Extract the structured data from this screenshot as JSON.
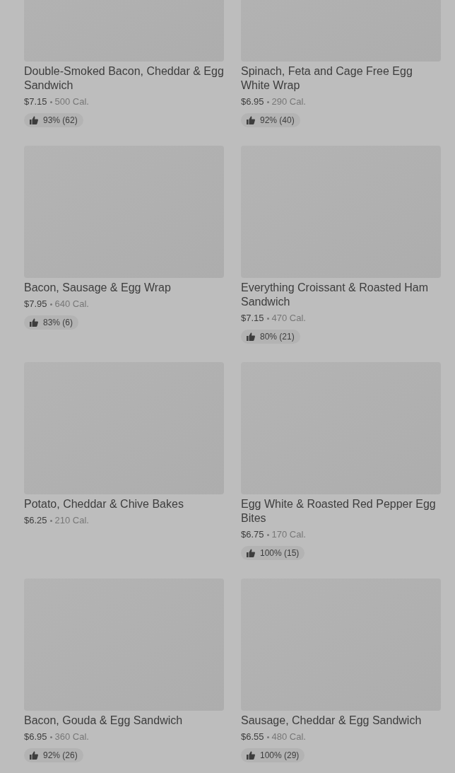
{
  "items": [
    {
      "name": "Double-Smoked Bacon, Cheddar & Egg Sandwich",
      "price": "$7.15",
      "calories": "500 Cal.",
      "rating": "93% (62)"
    },
    {
      "name": "Spinach, Feta and Cage Free Egg White Wrap",
      "price": "$6.95",
      "calories": "290 Cal.",
      "rating": "92% (40)"
    },
    {
      "name": "Bacon, Sausage & Egg Wrap",
      "price": "$7.95",
      "calories": "640 Cal.",
      "rating": "83% (6)"
    },
    {
      "name": "Everything Croissant & Roasted Ham Sandwich",
      "price": "$7.15",
      "calories": "470 Cal.",
      "rating": "80% (21)"
    },
    {
      "name": "Potato, Cheddar & Chive Bakes",
      "price": "$6.25",
      "calories": "210 Cal."
    },
    {
      "name": "Egg White & Roasted Red Pepper Egg Bites",
      "price": "$6.75",
      "calories": "170 Cal.",
      "rating": "100% (15)"
    },
    {
      "name": "Bacon, Gouda & Egg Sandwich",
      "price": "$6.95",
      "calories": "360 Cal.",
      "rating": "92% (26)"
    },
    {
      "name": "Sausage, Cheddar & Egg Sandwich",
      "price": "$6.55",
      "calories": "480 Cal.",
      "rating": "100% (29)"
    }
  ]
}
